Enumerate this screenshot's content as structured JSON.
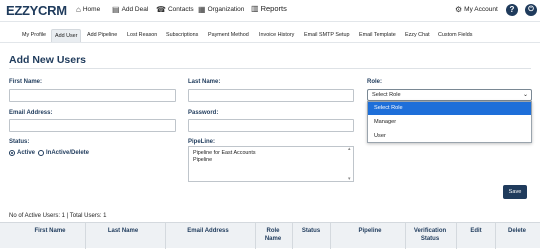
{
  "header": {
    "logo": "EZZYCRM",
    "nav": [
      {
        "icon": "home-icon",
        "glyph": "⌂",
        "label": "Home"
      },
      {
        "icon": "add-deal-icon",
        "glyph": "▤",
        "label": "Add Deal"
      },
      {
        "icon": "contacts-icon",
        "glyph": "☎",
        "label": "Contacts"
      },
      {
        "icon": "organization-icon",
        "glyph": "▦",
        "label": "Organization"
      },
      {
        "icon": "reports-icon",
        "glyph": "▥",
        "label": "Reports"
      }
    ],
    "account": {
      "icon": "gear-icon",
      "glyph": "⚙",
      "label": "My Account"
    },
    "help_glyph": "?",
    "power_glyph": "⏻"
  },
  "subnav": {
    "tabs": [
      "My Profile",
      "Add User",
      "Add Pipeline",
      "Lost Reason",
      "Subscriptions",
      "Payment Method",
      "Invoice History",
      "Email SMTP Setup",
      "Email Template",
      "Ezzy Chat",
      "Custom Fields"
    ],
    "active": "Add User"
  },
  "form": {
    "title": "Add New Users",
    "first_name_label": "First Name:",
    "last_name_label": "Last Name:",
    "role_label": "Role:",
    "email_label": "Email Address:",
    "password_label": "Password:",
    "status_label": "Status:",
    "status_options": [
      "Active",
      "InActive/Delete"
    ],
    "status_selected": "Active",
    "pipeline_label": "PipeLine:",
    "pipelines": [
      "Pipeline for East Accounts",
      "Pipeline"
    ],
    "role_select": {
      "value": "Select Role",
      "options": [
        "Select Role",
        "Manager",
        "User"
      ],
      "highlighted": "Select Role"
    },
    "save_label": "Save"
  },
  "summary": "No of Active Users: 1 | Total Users: 1",
  "table": {
    "columns": [
      "First Name",
      "Last Name",
      "Email Address",
      "Role Name",
      "Status",
      "Pipeline",
      "Verification Status",
      "Edit",
      "Delete"
    ]
  },
  "colors": {
    "primary": "#1f3b5c",
    "highlight": "#1e6fd9"
  }
}
